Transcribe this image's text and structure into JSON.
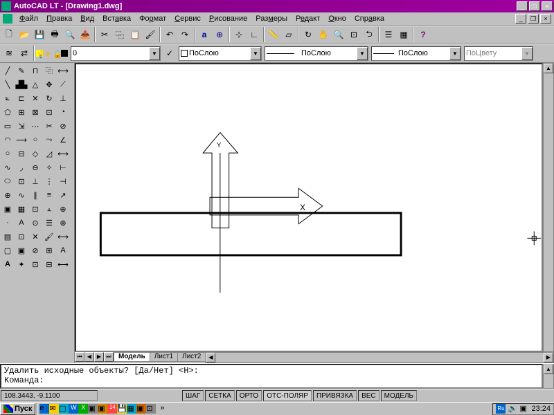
{
  "title": {
    "app": "AutoCAD LT",
    "sep": " - ",
    "doc": "[Drawing1.dwg]"
  },
  "menu": [
    "Файл",
    "Правка",
    "Вид",
    "Вставка",
    "Формат",
    "Сервис",
    "Рисование",
    "Размеры",
    "Редакт",
    "Окно",
    "Справка"
  ],
  "layer_dropdown": "0",
  "prop_dropdowns": [
    "ПоСлою",
    "ПоСлою",
    "ПоСлою",
    "ПоЦвету"
  ],
  "tabs": {
    "model": "Модель",
    "sheet1": "Лист1",
    "sheet2": "Лист2"
  },
  "command": {
    "line1": "Удалить исходные объекты? [Да/Нет] <Н>:",
    "line2": "Команда:"
  },
  "status": {
    "coords": "108.3443, -9.1100",
    "toggles": [
      "ШАГ",
      "СЕТКА",
      "ОРТО",
      "ОТС-ПОЛЯР",
      "ПРИВЯЗКА",
      "ВЕС",
      "МОДЕЛЬ"
    ]
  },
  "taskbar": {
    "start": "Пуск",
    "clock": "23:24"
  },
  "winbtns": {
    "min": "0",
    "max": "1",
    "close": "r"
  }
}
